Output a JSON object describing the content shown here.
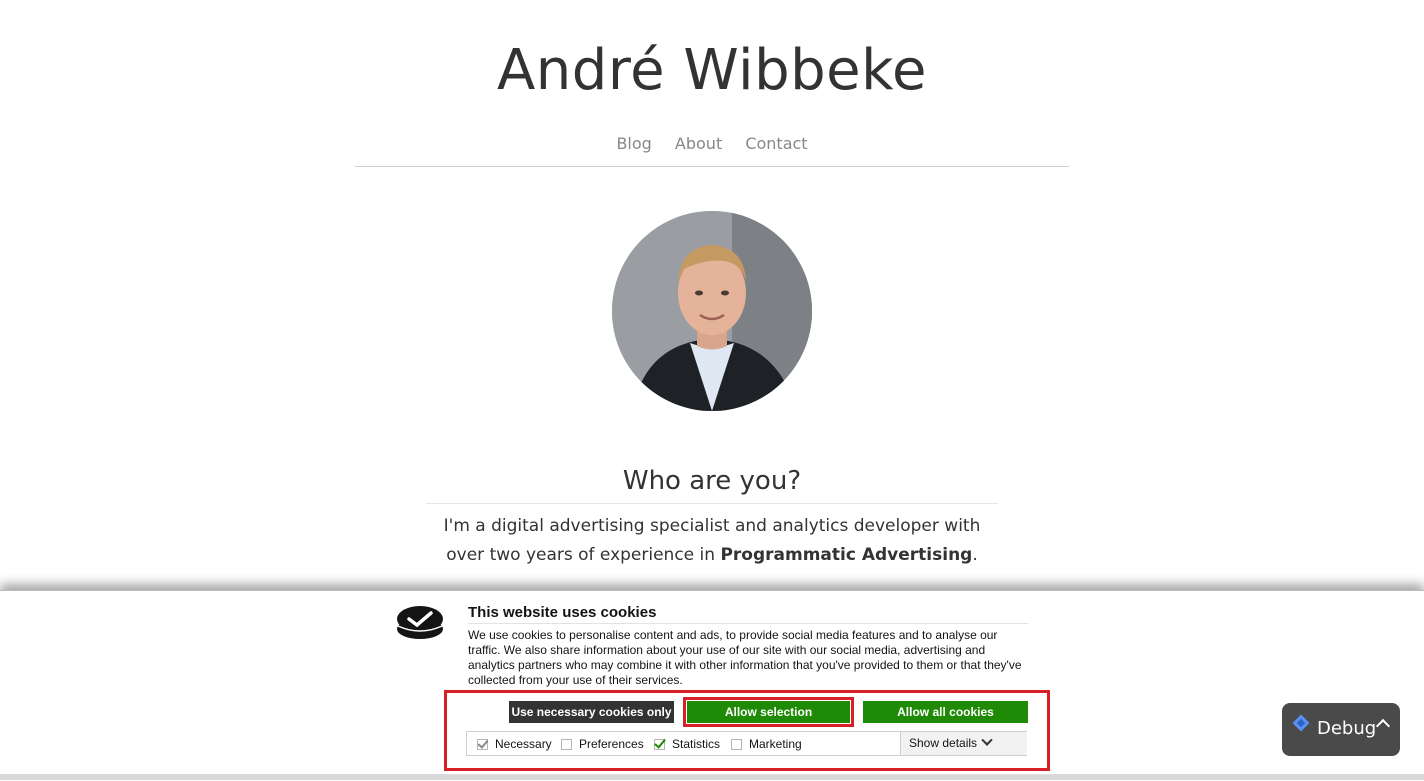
{
  "site": {
    "title": "André Wibbeke",
    "nav": [
      "Blog",
      "About",
      "Contact"
    ]
  },
  "hero": {
    "heading": "Who are you?",
    "intro_pre": "I'm a digital advertising specialist and analytics developer with over two years of experience in ",
    "intro_bold": "Programmatic Advertising",
    "intro_post": "."
  },
  "cookie_banner": {
    "title": "This website uses cookies",
    "text": "We use cookies to personalise content and ads, to provide social media features and to analyse our traffic. We also share information about your use of our site with our social media, advertising and analytics partners who may combine it with other information that you've provided to them or that they've collected from your use of their services.",
    "buttons": {
      "necessary_only": "Use necessary cookies only",
      "allow_selection": "Allow selection",
      "allow_all": "Allow all cookies"
    },
    "options": {
      "necessary": "Necessary",
      "preferences": "Preferences",
      "statistics": "Statistics",
      "marketing": "Marketing"
    },
    "show_details": "Show details"
  },
  "debug": {
    "label": "Debug"
  },
  "colors": {
    "accent_green": "#1f8a06",
    "highlight_red": "#d61f26",
    "dark_button": "#333333"
  }
}
